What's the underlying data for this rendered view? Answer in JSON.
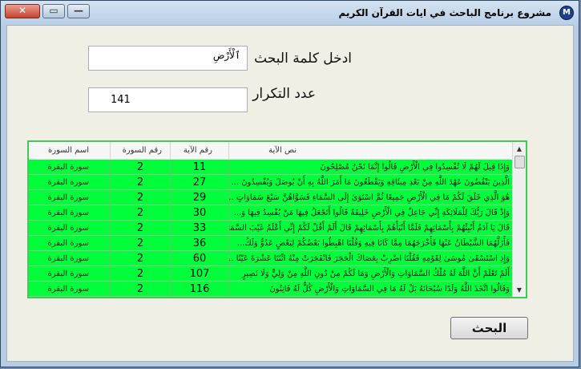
{
  "window": {
    "title": "مشروع برنامج الباحث في ايات القرآن الكريم",
    "icon_letter": "M",
    "controls": {
      "close": "✕",
      "maximize": "▭",
      "minimize": "—"
    }
  },
  "search": {
    "label": "ادخل كلمة البحث",
    "value": "ٱلْأَرْضِ"
  },
  "count": {
    "label": "عدد التكرار",
    "value": "141"
  },
  "table": {
    "headers": {
      "surah_name": "اسم السورة",
      "surah_number": "رقم السورة",
      "ayah_number": "رقم الآية",
      "ayah_text": "نص الآية"
    },
    "rows": [
      {
        "surah_name": "سورة البقرة",
        "surah_number": "2",
        "ayah_number": "11",
        "ayah_text": "وَإِذَا قِيلَ لَهُمْ لَا تُفْسِدُوا فِي الْأَرْضِ قَالُوا إِنَّمَا نَحْنُ مُصْلِحُونَ"
      },
      {
        "surah_name": "سورة البقرة",
        "surah_number": "2",
        "ayah_number": "27",
        "ayah_text": "الَّذِينَ يَنْقُضُونَ عَهْدَ اللَّهِ مِنْ بَعْدِ مِيثَاقِهِ وَيَقْطَعُونَ مَا أَمَرَ اللَّهُ بِهِ أَنْ يُوصَلَ وَيُفْسِدُونَ ..."
      },
      {
        "surah_name": "سورة البقرة",
        "surah_number": "2",
        "ayah_number": "29",
        "ayah_text": "هُوَ الَّذِي خَلَقَ لَكُمْ مَا فِي الْأَرْضِ جَمِيعًا ثُمَّ اسْتَوَىٰ إِلَى السَّمَاءِ فَسَوَّاهُنَّ سَبْعَ سَمَاوَاتٍ ..."
      },
      {
        "surah_name": "سورة البقرة",
        "surah_number": "2",
        "ayah_number": "30",
        "ayah_text": "وَإِذْ قَالَ رَبُّكَ لِلْمَلَائِكَةِ إِنِّي جَاعِلٌ فِي الْأَرْضِ خَلِيفَةً قَالُوا أَتَجْعَلُ فِيهَا مَنْ يُفْسِدُ فِيهَا وَ..."
      },
      {
        "surah_name": "سورة البقرة",
        "surah_number": "2",
        "ayah_number": "33",
        "ayah_text": "قَالَ يَا آدَمُ أَنْبِئْهُمْ بِأَسْمَائِهِمْ فَلَمَّا أَنْبَأَهُمْ بِأَسْمَائِهِمْ قَالَ أَلَمْ أَقُلْ لَكُمْ إِنِّي أَعْلَمُ غَيْبَ السَّمَاوَ..."
      },
      {
        "surah_name": "سورة البقرة",
        "surah_number": "2",
        "ayah_number": "36",
        "ayah_text": "فَأَزَلَّهُمَا الشَّيْطَانُ عَنْهَا فَأَخْرَجَهُمَا مِمَّا كَانَا فِيهِ وَقُلْنَا اهْبِطُوا بَعْضُكُمْ لِبَعْضٍ عَدُوٌّ وَلَكُ..."
      },
      {
        "surah_name": "سورة البقرة",
        "surah_number": "2",
        "ayah_number": "60",
        "ayah_text": "وَإِذِ اسْتَسْقَىٰ مُوسَىٰ لِقَوْمِهِ فَقُلْنَا اضْرِبْ بِعَصَاكَ الْحَجَرَ فَانْفَجَرَتْ مِنْهُ اثْنَتَا عَشْرَةَ عَيْنًا ..."
      },
      {
        "surah_name": "سورة البقرة",
        "surah_number": "2",
        "ayah_number": "107",
        "ayah_text": "أَلَمْ تَعْلَمْ أَنَّ اللَّهَ لَهُ مُلْكُ السَّمَاوَاتِ وَالْأَرْضِ وَمَا لَكُمْ مِنْ دُونِ اللَّهِ مِنْ وَلِيٍّ وَلَا نَصِيرٍ"
      },
      {
        "surah_name": "سورة البقرة",
        "surah_number": "2",
        "ayah_number": "116",
        "ayah_text": "وَقَالُوا اتَّخَذَ اللَّهُ وَلَدًا سُبْحَانَهُ بَلْ لَهُ مَا فِي السَّمَاوَاتِ وَالْأَرْضِ كُلٌّ لَهُ قَانِتُونَ"
      }
    ]
  },
  "search_button": {
    "label": "البحث"
  },
  "scrollbar": {
    "up": "▲",
    "down": "▼"
  },
  "colors": {
    "row_highlight": "#00ff3a",
    "grid_border": "#46c75a"
  }
}
